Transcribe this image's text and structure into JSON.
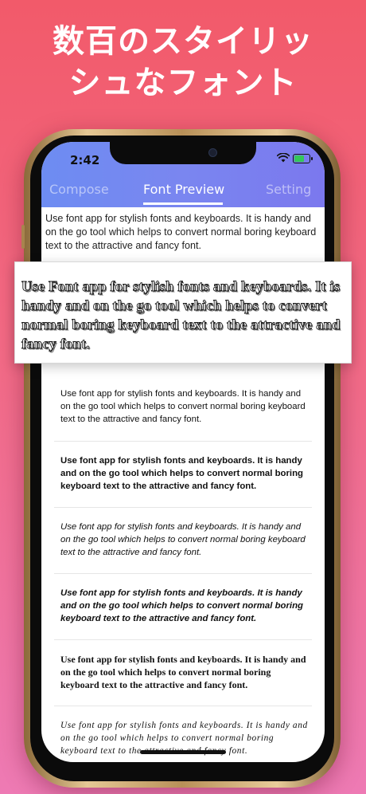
{
  "headline": {
    "line1": "数百のスタイリッ",
    "line2": "シュなフォント"
  },
  "status_bar": {
    "time": "2:42",
    "wifi_icon": "wifi-icon",
    "battery_icon": "battery-charging-icon",
    "battery_color": "#34c759"
  },
  "tabs": [
    {
      "label": "Compose",
      "active": false
    },
    {
      "label": "Font Preview",
      "active": true
    },
    {
      "label": "Setting",
      "active": false
    }
  ],
  "compose_text": "Use font app for stylish fonts and keyboards. It is handy and on the go tool which helps to convert normal boring keyboard text to the attractive and fancy font.",
  "highlighted_preview": "Use Font app for stylish fonts and keyboards. It is handy and on the go tool which helps to convert normal boring keyboard text to the attractive and fancy font.",
  "font_previews": [
    {
      "text": "Use font app for stylish fonts and keyboards. It is handy and on the go tool which helps to convert normal boring keyboard text to the attractive and fancy font."
    },
    {
      "text": "Use font app for stylish fonts and keyboards. It is handy and on the go tool which helps to convert normal boring keyboard text to the attractive and fancy font."
    },
    {
      "text": "Use font app for stylish fonts and keyboards. It is handy and on the go tool which helps to convert normal boring keyboard text to the attractive and fancy font."
    },
    {
      "text": "Use font app for stylish fonts and keyboards. It is handy and on the go tool which helps to convert normal boring keyboard text to the attractive and fancy font."
    },
    {
      "text": "Use font app for stylish fonts and keyboards. It is handy and on the go tool which helps to convert normal boring keyboard text to the attractive and fancy font."
    },
    {
      "text": "Use font app for stylish fonts and keyboards. It is handy and on the go tool which helps to convert normal boring keyboard text to the attractive and fancy font."
    }
  ],
  "colors": {
    "background_top": "#f25a6a",
    "background_bottom": "#ee7ab4",
    "nav_gradient_start": "#6d8cf2",
    "nav_gradient_end": "#7b78ee",
    "phone_frame": "#c9a46c"
  }
}
